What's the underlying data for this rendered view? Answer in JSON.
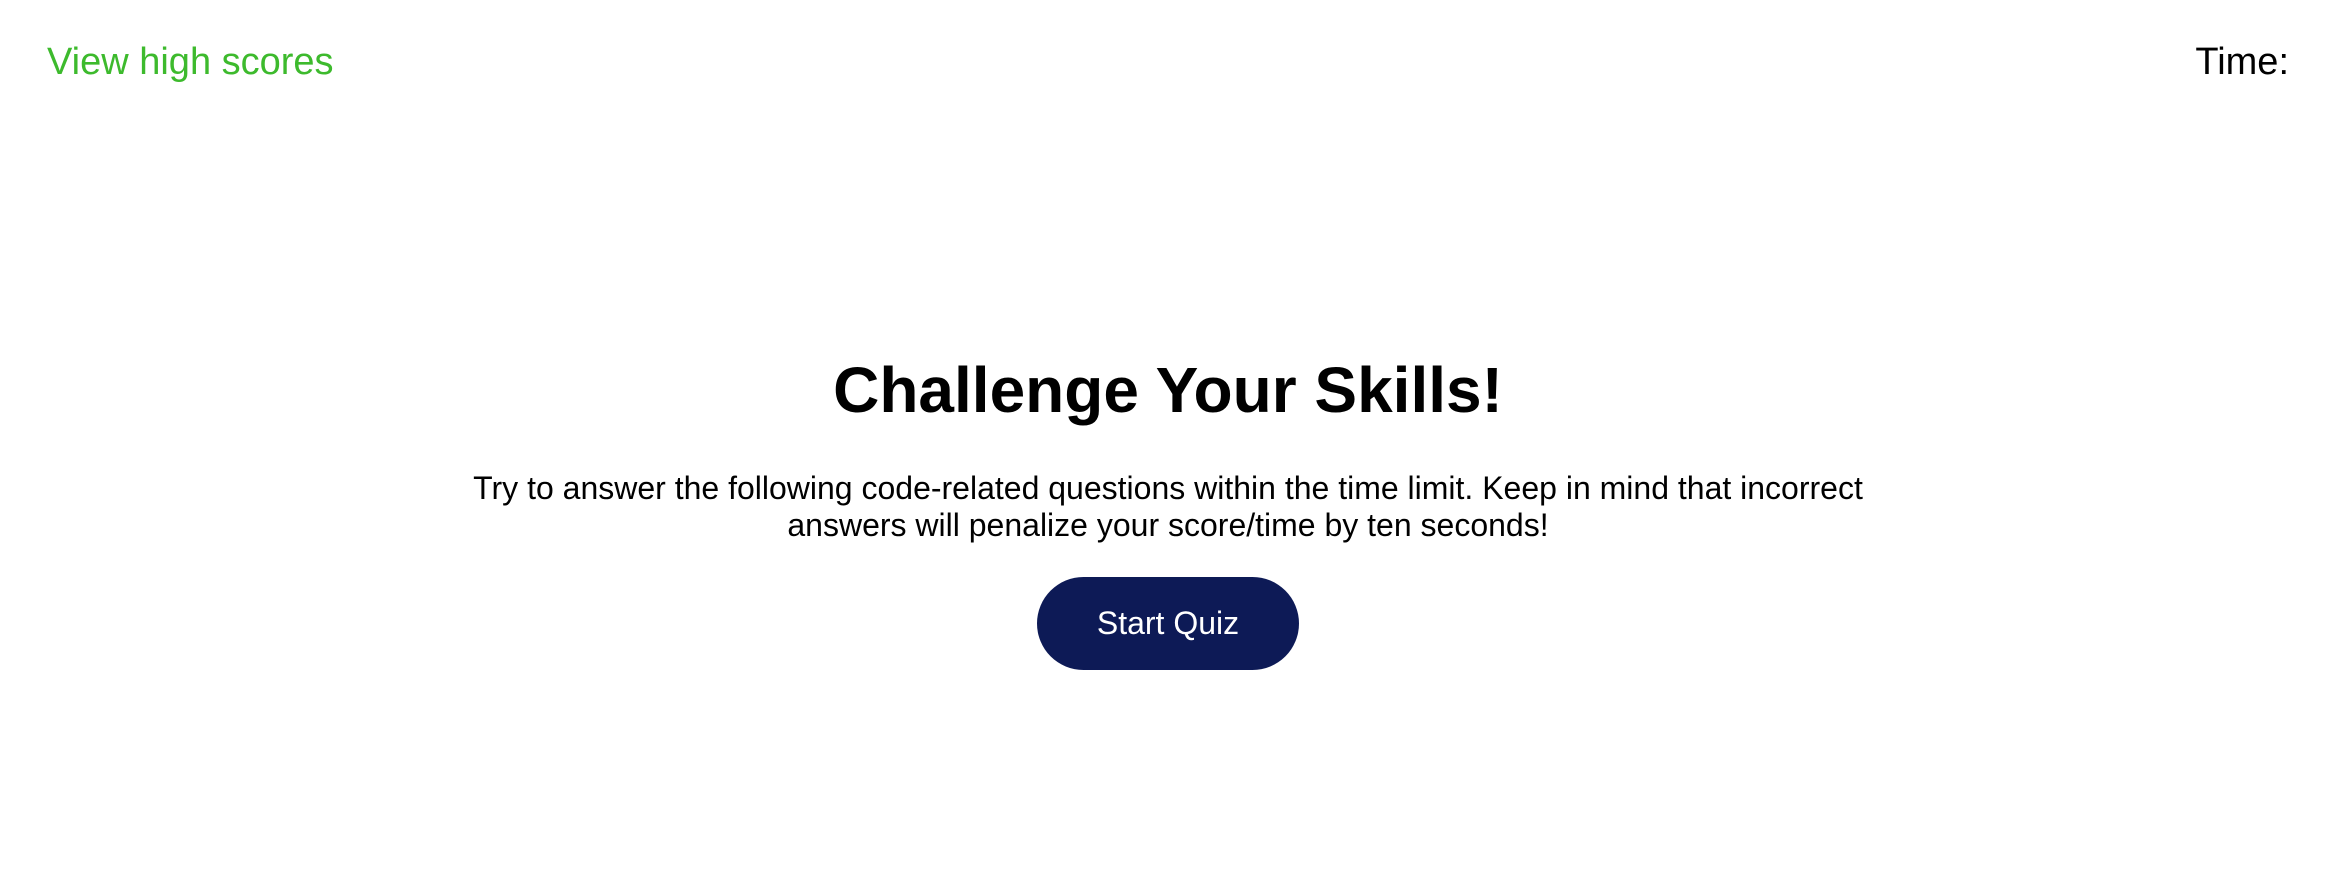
{
  "header": {
    "high_scores_label": "View high scores",
    "timer_label": "Time:"
  },
  "intro": {
    "title": "Challenge Your Skills!",
    "description": "Try to answer the following code-related questions within the time limit. Keep in mind that incorrect answers will penalize your score/time by ten seconds!",
    "start_button_label": "Start Quiz"
  },
  "colors": {
    "link": "#3dba2d",
    "button_background": "#0d1a56",
    "button_text": "#ffffff",
    "text": "#000000",
    "background": "#ffffff"
  }
}
